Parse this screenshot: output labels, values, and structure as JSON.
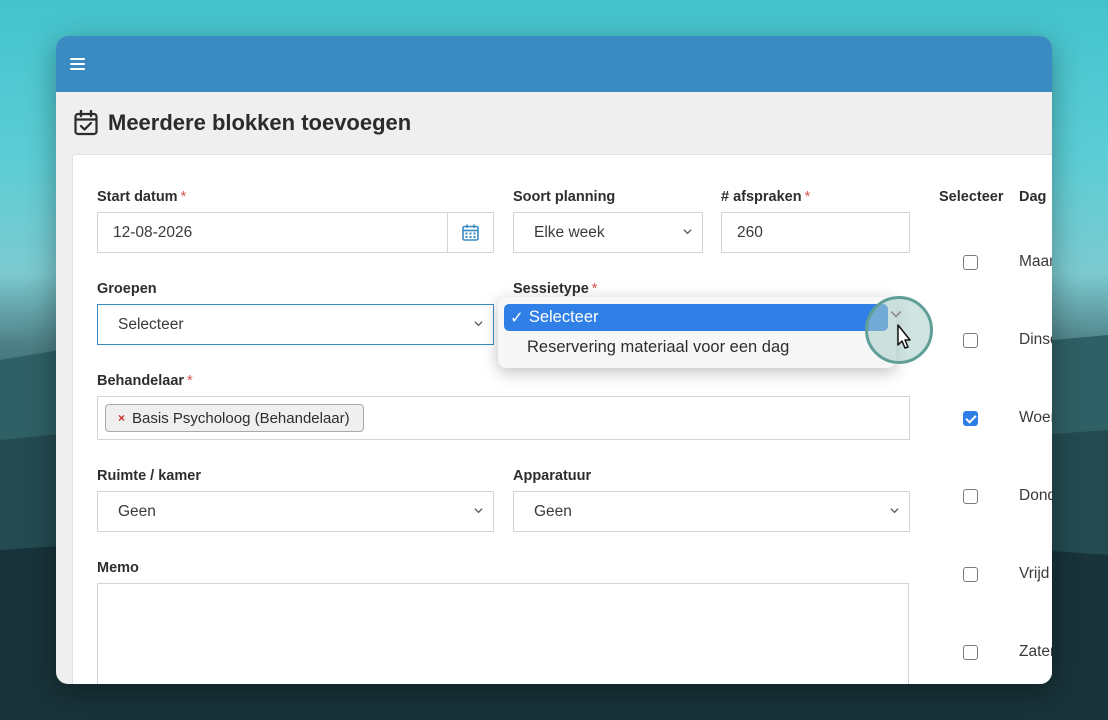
{
  "page": {
    "title": "Meerdere blokken toevoegen"
  },
  "form": {
    "start_datum": {
      "label": "Start datum",
      "required": "*",
      "value": "12-08-2026"
    },
    "soort_planning": {
      "label": "Soort planning",
      "value": "Elke week"
    },
    "afspraken": {
      "label": "# afspraken",
      "required": "*",
      "value": "260"
    },
    "groepen": {
      "label": "Groepen",
      "value": "Selecteer"
    },
    "sessietype": {
      "label": "Sessietype",
      "required": "*",
      "options": [
        {
          "label": "Selecteer",
          "check": "✓",
          "selected": true
        },
        {
          "label": "Reservering materiaal voor een dag",
          "selected": false
        }
      ]
    },
    "behandelaar": {
      "label": "Behandelaar",
      "required": "*",
      "tag": "Basis Psycholoog (Behandelaar)",
      "tag_remove": "×"
    },
    "ruimte": {
      "label": "Ruimte / kamer",
      "value": "Geen"
    },
    "apparatuur": {
      "label": "Apparatuur",
      "value": "Geen"
    },
    "memo": {
      "label": "Memo"
    }
  },
  "days_table": {
    "headers": {
      "select": "Selecteer",
      "day": "Dag"
    },
    "rows": [
      {
        "day": "Maan",
        "checked": false
      },
      {
        "day": "Dinsd",
        "checked": false
      },
      {
        "day": "Woen",
        "checked": true
      },
      {
        "day": "Dond",
        "checked": false
      },
      {
        "day": "Vrijd",
        "checked": false
      },
      {
        "day": "Zater",
        "checked": false
      }
    ]
  },
  "colors": {
    "topbar": "#3a8bc1",
    "accent": "#2f7fe6",
    "required": "#d9534f"
  },
  "icons": {
    "menu": "hamburger-icon",
    "page": "calendar-check-icon",
    "date": "calendar-icon",
    "select": "chevron-down-icon",
    "pointer": "mouse-pointer-icon"
  }
}
